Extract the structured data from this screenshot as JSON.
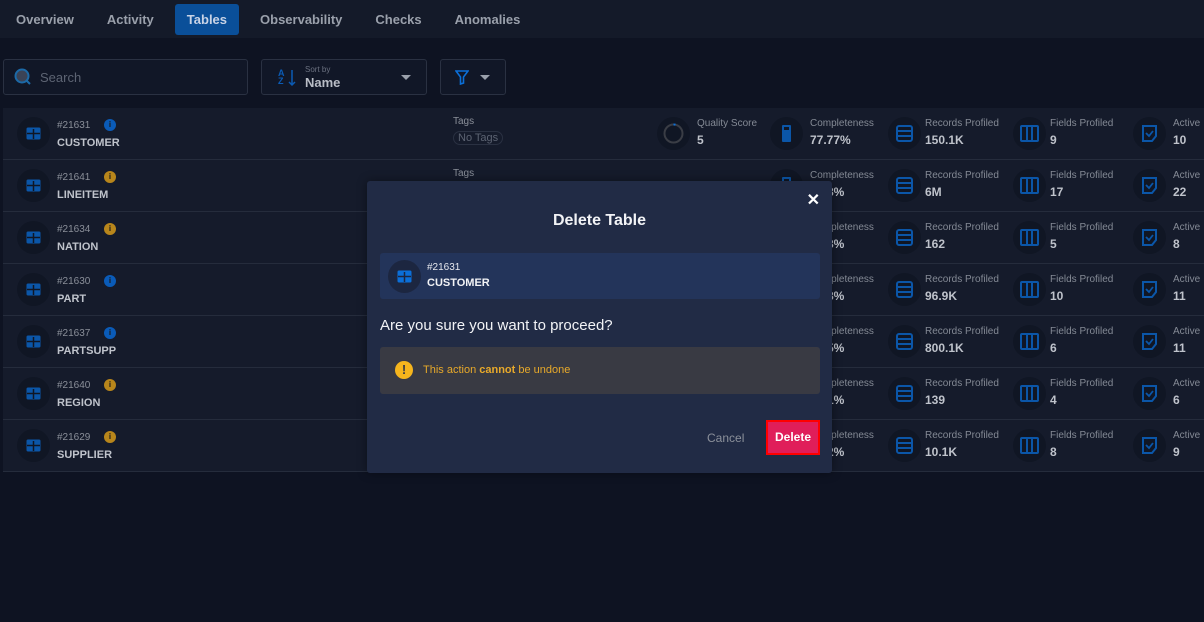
{
  "tabs": [
    {
      "label": "Overview"
    },
    {
      "label": "Activity"
    },
    {
      "label": "Tables",
      "active": true
    },
    {
      "label": "Observability"
    },
    {
      "label": "Checks"
    },
    {
      "label": "Anomalies"
    }
  ],
  "search": {
    "placeholder": "Search",
    "value": ""
  },
  "sort": {
    "label": "Sort by",
    "value": "Name"
  },
  "labels": {
    "tags": "Tags",
    "no_tags": "No Tags",
    "quality": "Quality Score",
    "completeness": "Completeness",
    "records": "Records Profiled",
    "fields": "Fields Profiled",
    "active": "Active"
  },
  "rows": [
    {
      "id": "#21631",
      "name": "CUSTOMER",
      "info": "#0a5bb8",
      "tags": "No Tags",
      "quality": "5",
      "completeness": "77.77%",
      "records": "150.1K",
      "fields": "9",
      "active": "10"
    },
    {
      "id": "#21641",
      "name": "LINEITEM",
      "info": "#b8861b",
      "completeness": "8%",
      "records": "6M",
      "fields": "17",
      "active": "22"
    },
    {
      "id": "#21634",
      "name": "NATION",
      "info": "#b8861b",
      "completeness": "3%",
      "records": "162",
      "fields": "5",
      "active": "8"
    },
    {
      "id": "#21630",
      "name": "PART",
      "info": "#0a5bb8",
      "completeness": "8%",
      "records": "96.9K",
      "fields": "10",
      "active": "11"
    },
    {
      "id": "#21637",
      "name": "PARTSUPP",
      "info": "#0a5bb8",
      "completeness": "5%",
      "records": "800.1K",
      "fields": "6",
      "active": "11"
    },
    {
      "id": "#21640",
      "name": "REGION",
      "info": "#b8861b",
      "completeness": "1%",
      "records": "139",
      "fields": "4",
      "active": "6"
    },
    {
      "id": "#21629",
      "name": "SUPPLIER",
      "info": "#b8861b",
      "completeness": "2%",
      "records": "10.1K",
      "fields": "8",
      "active": "9"
    }
  ],
  "modal": {
    "title": "Delete Table",
    "table_id": "#21631",
    "table_name": "CUSTOMER",
    "question": "Are you sure you want to proceed?",
    "warning_pre": "This action ",
    "warning_bold": "cannot",
    "warning_post": " be undone",
    "cancel": "Cancel",
    "delete": "Delete"
  },
  "colors": {
    "accent": "#0a4f99",
    "danger": "#e01e5a",
    "warning": "#f6b51d"
  }
}
